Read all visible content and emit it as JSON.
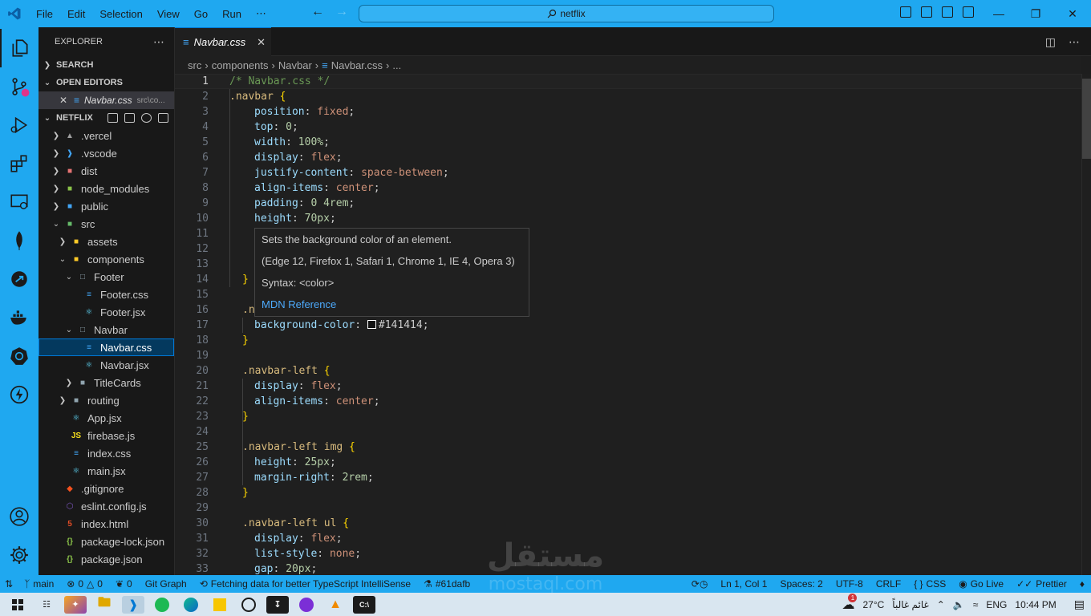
{
  "titlebar": {
    "menu": [
      "File",
      "Edit",
      "Selection",
      "View",
      "Go",
      "Run",
      "⋯"
    ],
    "search": "netflix",
    "accent": "#1fa8f0"
  },
  "sidebar": {
    "title": "EXPLORER",
    "search_section": "SEARCH",
    "open_editors_section": "OPEN EDITORS",
    "open_editor": {
      "name": "Navbar.css",
      "path": "src\\co..."
    },
    "project": "NETFLIX",
    "tree": [
      {
        "label": ".vercel",
        "icon": "vercel-folder-icon"
      },
      {
        "label": ".vscode",
        "icon": "vscode-folder-icon"
      },
      {
        "label": "dist",
        "icon": "dist-folder-icon"
      },
      {
        "label": "node_modules",
        "icon": "node-folder-icon"
      },
      {
        "label": "public",
        "icon": "public-folder-icon"
      },
      {
        "label": "src",
        "icon": "src-folder-icon"
      },
      {
        "label": "assets",
        "icon": "assets-folder-icon"
      },
      {
        "label": "components",
        "icon": "components-folder-icon"
      },
      {
        "label": "Footer",
        "icon": "folder-open-icon"
      },
      {
        "label": "Footer.css",
        "icon": "css-file-icon"
      },
      {
        "label": "Footer.jsx",
        "icon": "react-file-icon"
      },
      {
        "label": "Navbar",
        "icon": "folder-open-icon"
      },
      {
        "label": "Navbar.css",
        "icon": "css-file-icon"
      },
      {
        "label": "Navbar.jsx",
        "icon": "react-file-icon"
      },
      {
        "label": "TitleCards",
        "icon": "folder-icon"
      },
      {
        "label": "routing",
        "icon": "folder-icon"
      },
      {
        "label": "App.jsx",
        "icon": "react-file-icon"
      },
      {
        "label": "firebase.js",
        "icon": "js-file-icon"
      },
      {
        "label": "index.css",
        "icon": "css-file-icon"
      },
      {
        "label": "main.jsx",
        "icon": "react-file-icon"
      },
      {
        "label": ".gitignore",
        "icon": "git-file-icon"
      },
      {
        "label": "eslint.config.js",
        "icon": "eslint-file-icon"
      },
      {
        "label": "index.html",
        "icon": "html-file-icon"
      },
      {
        "label": "package-lock.json",
        "icon": "json-file-icon"
      },
      {
        "label": "package.json",
        "icon": "json-file-icon"
      }
    ]
  },
  "editor": {
    "tab": "Navbar.css",
    "breadcrumb": [
      "src",
      "components",
      "Navbar",
      "Navbar.css",
      "..."
    ],
    "line_numbers": [
      "1",
      "2",
      "3",
      "4",
      "5",
      "6",
      "7",
      "8",
      "9",
      "10",
      "11",
      "12",
      "13",
      "14",
      "15",
      "16",
      "17",
      "18",
      "19",
      "20",
      "21",
      "22",
      "23",
      "24",
      "25",
      "26",
      "27",
      "28",
      "29",
      "30",
      "31",
      "32",
      "33"
    ],
    "code": {
      "l1": "/* Navbar.css */",
      "l2_sel": ".navbar",
      "l2_brace": " {",
      "l3_prop": "position",
      "l3_val": "fixed",
      "l4_prop": "top",
      "l4_val": "0",
      "l5_prop": "width",
      "l5_val": "100%",
      "l6_prop": "display",
      "l6_val": "flex",
      "l7_prop": "justify-content",
      "l7_val": "space-between",
      "l8_prop": "align-items",
      "l8_val": "center",
      "l9_prop": "padding",
      "l9_val": "0 4rem",
      "l10_prop": "height",
      "l10_val": "70px",
      "l14": "}",
      "l16": ".n",
      "l17_prop": "background-color",
      "l17_val": "#141414",
      "l18": "}",
      "l20_sel": ".navbar-left",
      "l20_brace": " {",
      "l21_prop": "display",
      "l21_val": "flex",
      "l22_prop": "align-items",
      "l22_val": "center",
      "l23": "}",
      "l25_sel": ".navbar-left img",
      "l25_brace": " {",
      "l26_prop": "height",
      "l26_val": "25px",
      "l27_prop": "margin-right",
      "l27_val": "2rem",
      "l28": "}",
      "l30_sel": ".navbar-left ul",
      "l30_brace": " {",
      "l31_prop": "display",
      "l31_val": "flex",
      "l32_prop": "list-style",
      "l32_val": "none",
      "l33_prop": "gap",
      "l33_val": "20px"
    },
    "hover": {
      "description": "Sets the background color of an element.",
      "browsers": "(Edge 12, Firefox 1, Safari 1, Chrome 1, IE 4, Opera 3)",
      "syntax": "Syntax: <color>",
      "link": "MDN Reference"
    }
  },
  "statusbar": {
    "branch": "main",
    "errors": "0",
    "warnings": "0",
    "ports": "0",
    "git_graph": "Git Graph",
    "message": "Fetching data for better TypeScript IntelliSense",
    "commit": "#61dafb",
    "position": "Ln 1, Col 1",
    "spaces": "Spaces: 2",
    "encoding": "UTF-8",
    "eol": "CRLF",
    "language": "CSS",
    "golive": "Go Live",
    "prettier": "Prettier"
  },
  "taskbar": {
    "weather_temp": "27°C",
    "weather_text": "غائم غالباً",
    "lang": "ENG",
    "time": "10:44 PM",
    "weather_badge": "1"
  },
  "watermark": {
    "arabic": "مستقل",
    "latin": "mostaql.com"
  }
}
